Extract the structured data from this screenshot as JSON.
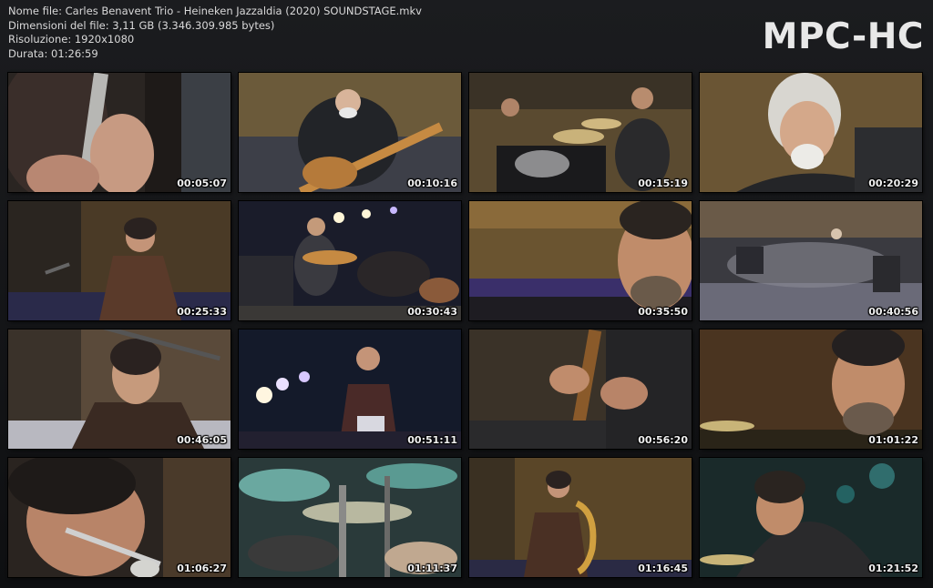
{
  "info": {
    "filename": "Nome file: Carles Benavent Trio - Heineken Jazzaldia (2020) SOUNDSTAGE.mkv",
    "filesize": "Dimensioni del file: 3,11 GB (3.346.309.985 bytes)",
    "resolution": "Risoluzione: 1920x1080",
    "duration": "Durata: 01:26:59"
  },
  "logo": "MPC-HC",
  "thumbnails": [
    {
      "time": "00:05:07",
      "scene": "clarinet-hands"
    },
    {
      "time": "00:10:16",
      "scene": "bass-player"
    },
    {
      "time": "00:15:19",
      "scene": "drummer"
    },
    {
      "time": "00:20:29",
      "scene": "bassist-closeup"
    },
    {
      "time": "00:25:33",
      "scene": "man-brown-jacket"
    },
    {
      "time": "00:30:43",
      "scene": "stage-wide"
    },
    {
      "time": "00:35:50",
      "scene": "drummer-closeup"
    },
    {
      "time": "00:40:56",
      "scene": "stage-overlay"
    },
    {
      "time": "00:46:05",
      "scene": "man-mic"
    },
    {
      "time": "00:51:11",
      "scene": "man-lights"
    },
    {
      "time": "00:56:20",
      "scene": "bass-hands"
    },
    {
      "time": "01:01:22",
      "scene": "drummer-cymbal"
    },
    {
      "time": "01:06:27",
      "scene": "clarinet-face"
    },
    {
      "time": "01:11:37",
      "scene": "drum-kit"
    },
    {
      "time": "01:16:45",
      "scene": "saxophone"
    },
    {
      "time": "01:21:52",
      "scene": "drummer-green"
    }
  ]
}
